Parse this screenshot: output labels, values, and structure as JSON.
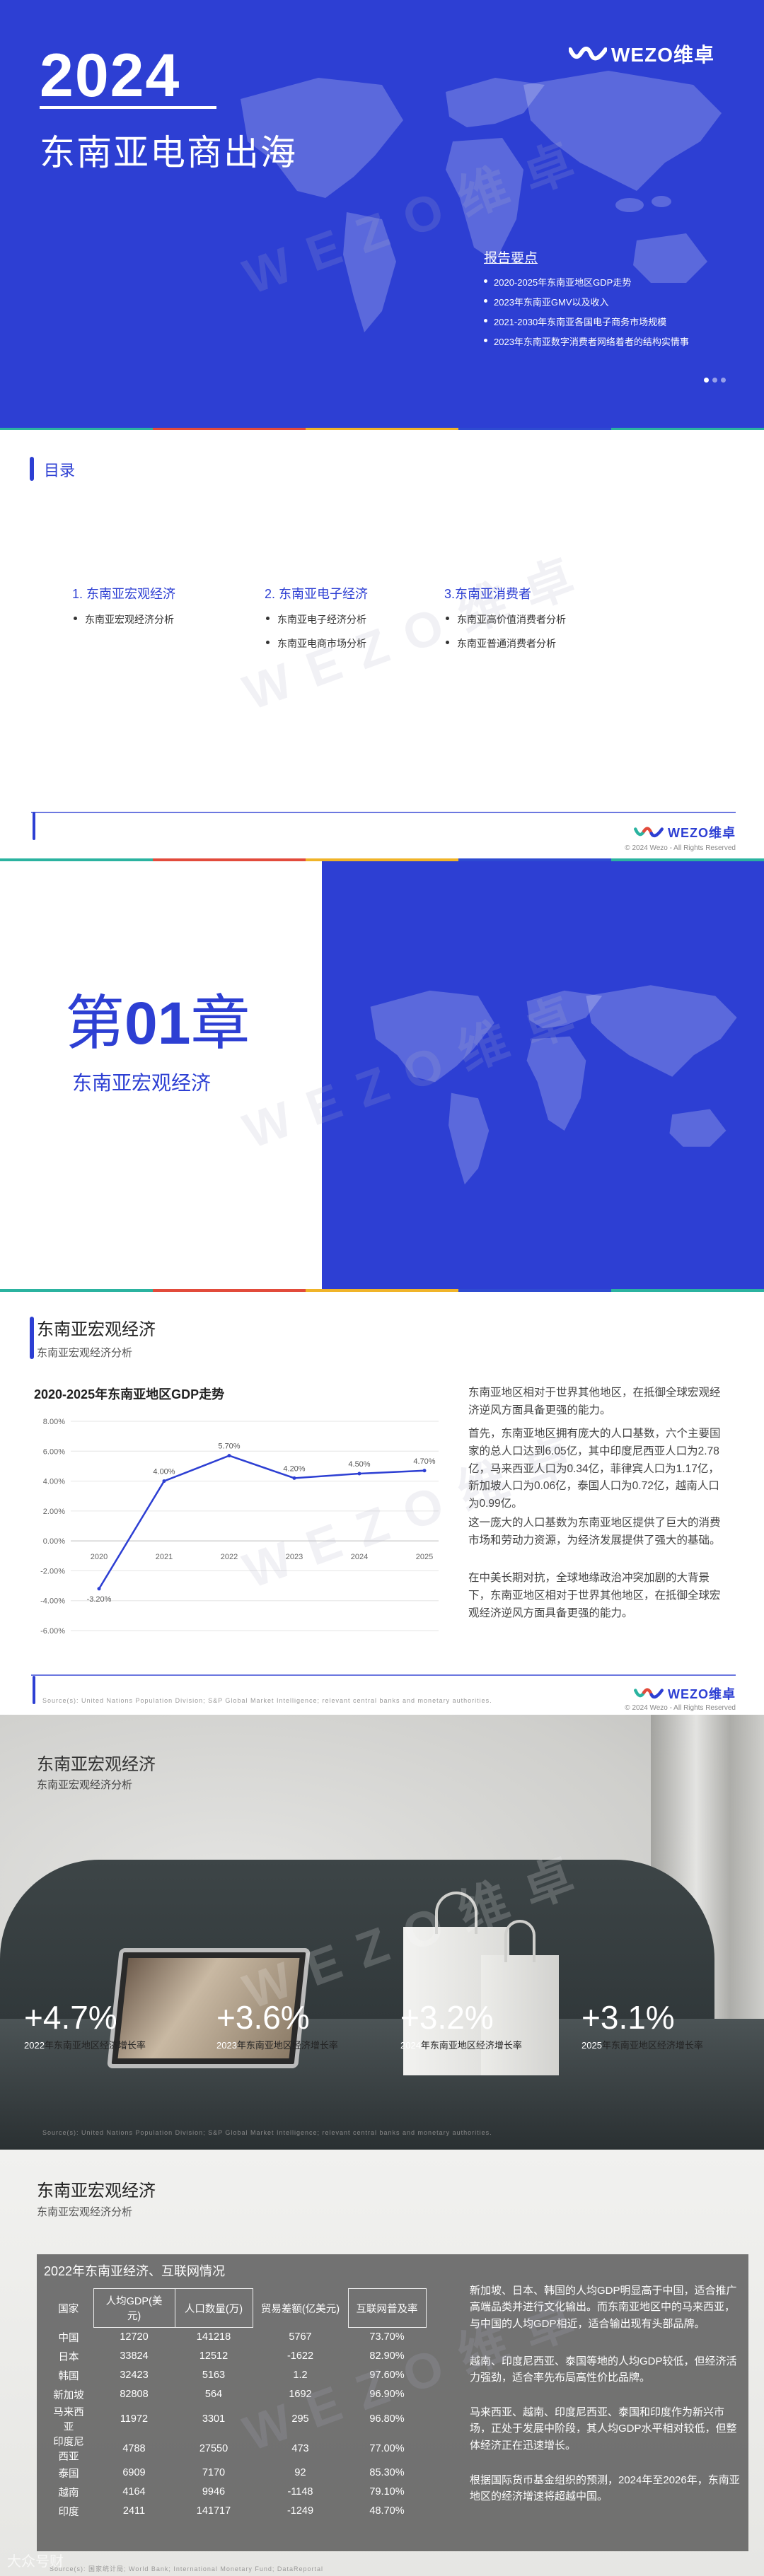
{
  "cover": {
    "year": "2024",
    "title": "东南亚电商出海",
    "logo_text": "WEZO维卓",
    "highlights_title": "报告要点",
    "highlights": [
      "2020-2025年东南亚地区GDP走势",
      "2023年东南亚GMV以及收入",
      "2021-2030年东南亚各国电子商务市场规模",
      "2023年东南亚数字消费者网络着者的结构实情事"
    ],
    "watermark": "WEZO维卓"
  },
  "toc": {
    "title": "目录",
    "columns": [
      {
        "heading": "1.  东南亚宏观经济",
        "items": [
          "东南亚宏观经济分析"
        ]
      },
      {
        "heading": "2. 东南亚电子经济",
        "items": [
          "东南亚电子经济分析",
          "东南亚电商市场分析"
        ]
      },
      {
        "heading": "3.东南亚消费者",
        "items": [
          "东南亚高价值消费者分析",
          "东南亚普通消费者分析"
        ]
      }
    ],
    "logo_text": "WEZO维卓",
    "copyright": "© 2024 Wezo - All Rights Reserved"
  },
  "chapter": {
    "prefix": "第",
    "number": "01",
    "suffix": "章",
    "subtitle": "东南亚宏观经济"
  },
  "gdp": {
    "title": "东南亚宏观经济",
    "subtitle": "东南亚宏观经济分析",
    "chart_title": "2020-2025年东南亚地区GDP走势",
    "paragraphs": [
      "东南亚地区相对于世界其他地区，在抵御全球宏观经济逆风方面具备更强的能力。",
      "首先，东南亚地区拥有庞大的人口基数，六个主要国家的总人口达到6.05亿，其中印度尼西亚人口为2.78亿，马来西亚人口为0.34亿，菲律宾人口为1.17亿，新加坡人口为0.06亿，泰国人口为0.72亿，越南人口为0.99亿。",
      "这一庞大的人口基数为东南亚地区提供了巨大的消费市场和劳动力资源，为经济发展提供了强大的基础。",
      "在中美长期对抗，全球地缘政治冲突加剧的大背景下，东南亚地区相对于世界其他地区，在抵御全球宏观经济逆风方面具备更强的能力。"
    ],
    "source": "Source(s): United Nations Population Division; S&P Global Market Intelligence; relevant central banks and monetary authorities.",
    "logo_text": "WEZO维卓",
    "copyright": "© 2024 Wezo - All Rights Reserved"
  },
  "chart_data": {
    "type": "line",
    "title": "2020-2025年东南亚地区GDP走势",
    "x": [
      "2020",
      "2021",
      "2022",
      "2023",
      "2024",
      "2025"
    ],
    "values": [
      -3.2,
      4.0,
      5.7,
      4.2,
      4.5,
      4.7
    ],
    "labels": [
      "-3.20%",
      "4.00%",
      "5.70%",
      "4.20%",
      "4.50%",
      "4.70%"
    ],
    "yticks": [
      "8.00%",
      "6.00%",
      "4.00%",
      "2.00%",
      "0.00%",
      "-2.00%",
      "-4.00%",
      "-6.00%"
    ],
    "ylim": [
      -6,
      8
    ],
    "color": "#2d3fd3",
    "grid": true
  },
  "photo": {
    "title": "东南亚宏观经济",
    "subtitle": "东南亚宏观经济分析",
    "stats": [
      {
        "value": "+4.7%",
        "year": "2022",
        "label": "年东南亚地区经济增长率"
      },
      {
        "value": "+3.6%",
        "year": "2023",
        "label": "年东南亚地区经济增长率"
      },
      {
        "value": "+3.2%",
        "year": "2024",
        "label": "年东南亚地区经济增长率"
      },
      {
        "value": "+3.1%",
        "year": "2025",
        "label": "年东南亚地区经济增长率"
      }
    ],
    "source": "Source(s): United Nations Population Division; S&P Global Market Intelligence; relevant central banks and monetary authorities."
  },
  "table": {
    "title": "东南亚宏观经济",
    "subtitle": "东南亚宏观经济分析",
    "table_title": "2022年东南亚经济、互联网情况",
    "headers": [
      "国家",
      "人均GDP(美元)",
      "人口数量(万)",
      "贸易差额(亿美元)",
      "互联网普及率"
    ],
    "rows": [
      [
        "中国",
        "12720",
        "141218",
        "5767",
        "73.70%"
      ],
      [
        "日本",
        "33824",
        "12512",
        "-1622",
        "82.90%"
      ],
      [
        "韩国",
        "32423",
        "5163",
        "1.2",
        "97.60%"
      ],
      [
        "新加坡",
        "82808",
        "564",
        "1692",
        "96.90%"
      ],
      [
        "马来西亚",
        "11972",
        "3301",
        "295",
        "96.80%"
      ],
      [
        "印度尼西亚",
        "4788",
        "27550",
        "473",
        "77.00%"
      ],
      [
        "泰国",
        "6909",
        "7170",
        "92",
        "85.30%"
      ],
      [
        "越南",
        "4164",
        "9946",
        "-1148",
        "79.10%"
      ],
      [
        "印度",
        "2411",
        "141717",
        "-1249",
        "48.70%"
      ]
    ],
    "paragraphs": [
      "新加坡、日本、韩国的人均GDP明显高于中国，适合推广高端品类并进行文化输出。而东南亚地区中的马来西亚，与中国的人均GDP相近，适合输出现有头部品牌。",
      "越南、印度尼西亚、泰国等地的人均GDP较低，但经济活力强劲，适合率先布局高性价比品牌。",
      "马来西亚、越南、印度尼西亚、泰国和印度作为新兴市场，正处于发展中阶段，其人均GDP水平相对较低，但整体经济正在迅速增长。",
      "根据国际货币基金组织的预测，2024年至2026年，东南亚地区的经济增速将超越中国。"
    ],
    "source": "Source(s): 国家统计局; World Bank; International Monetary Fund; DataReportal",
    "watermark": "大众号财"
  }
}
